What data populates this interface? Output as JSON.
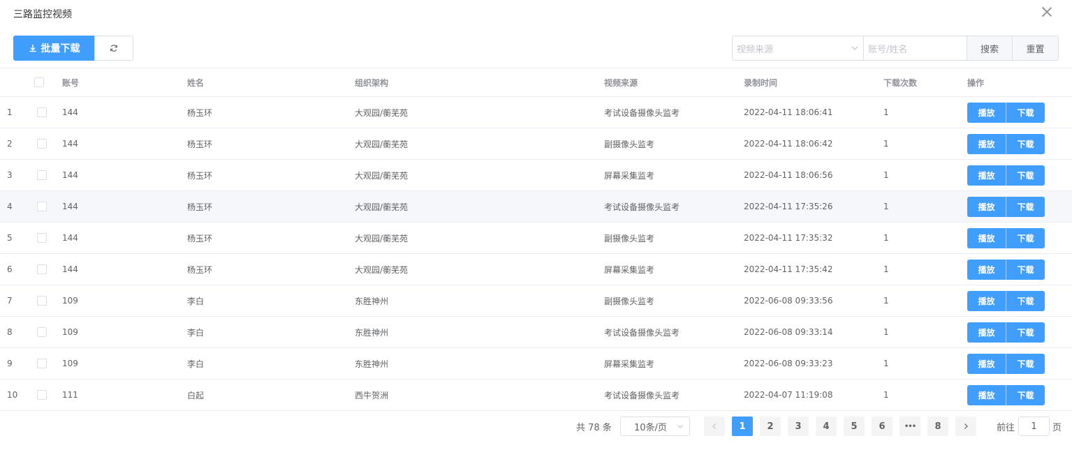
{
  "dialog": {
    "title": "三路监控视频"
  },
  "toolbar": {
    "batch_download_label": "批量下载"
  },
  "filters": {
    "source_placeholder": "视频来源",
    "account_placeholder": "账号/姓名",
    "search_label": "搜索",
    "reset_label": "重置"
  },
  "table": {
    "headers": {
      "account": "账号",
      "name": "姓名",
      "org": "组织架构",
      "source": "视频来源",
      "time": "录制时间",
      "count": "下载次数",
      "op": "操作"
    },
    "rows": [
      {
        "idx": "1",
        "account": "144",
        "name": "杨玉环",
        "org": "大观园/蘅芜苑",
        "source": "考试设备摄像头监考",
        "time": "2022-04-11 18:06:41",
        "count": "1"
      },
      {
        "idx": "2",
        "account": "144",
        "name": "杨玉环",
        "org": "大观园/蘅芜苑",
        "source": "副摄像头监考",
        "time": "2022-04-11 18:06:42",
        "count": "1"
      },
      {
        "idx": "3",
        "account": "144",
        "name": "杨玉环",
        "org": "大观园/蘅芜苑",
        "source": "屏幕采集监考",
        "time": "2022-04-11 18:06:56",
        "count": "1"
      },
      {
        "idx": "4",
        "account": "144",
        "name": "杨玉环",
        "org": "大观园/蘅芜苑",
        "source": "考试设备摄像头监考",
        "time": "2022-04-11 17:35:26",
        "count": "1"
      },
      {
        "idx": "5",
        "account": "144",
        "name": "杨玉环",
        "org": "大观园/蘅芜苑",
        "source": "副摄像头监考",
        "time": "2022-04-11 17:35:32",
        "count": "1"
      },
      {
        "idx": "6",
        "account": "144",
        "name": "杨玉环",
        "org": "大观园/蘅芜苑",
        "source": "屏幕采集监考",
        "time": "2022-04-11 17:35:42",
        "count": "1"
      },
      {
        "idx": "7",
        "account": "109",
        "name": "李白",
        "org": "东胜神州",
        "source": "副摄像头监考",
        "time": "2022-06-08 09:33:56",
        "count": "1"
      },
      {
        "idx": "8",
        "account": "109",
        "name": "李白",
        "org": "东胜神州",
        "source": "考试设备摄像头监考",
        "time": "2022-06-08 09:33:14",
        "count": "1"
      },
      {
        "idx": "9",
        "account": "109",
        "name": "李白",
        "org": "东胜神州",
        "source": "屏幕采集监考",
        "time": "2022-06-08 09:33:23",
        "count": "1"
      },
      {
        "idx": "10",
        "account": "111",
        "name": "白起",
        "org": "西牛贺洲",
        "source": "考试设备摄像头监考",
        "time": "2022-04-07 11:19:08",
        "count": "1"
      }
    ],
    "play_label": "播放",
    "download_label": "下载"
  },
  "pagination": {
    "total_label": "共 78 条",
    "page_size": "10条/页",
    "pages": [
      "1",
      "2",
      "3",
      "4",
      "5",
      "6",
      "8"
    ],
    "ellipsis": "•••",
    "current": "1",
    "goto_prefix": "前往",
    "goto_value": "1",
    "goto_suffix": "页"
  },
  "colors": {
    "primary": "#409eff",
    "border": "#dcdfe6",
    "hover_row": "#f5f7fa"
  },
  "icons": {
    "close": "close-icon",
    "download": "download-icon",
    "refresh": "refresh-icon",
    "chevron": "chevron-down-icon",
    "prev": "chevron-left-icon",
    "next": "chevron-right-icon"
  }
}
